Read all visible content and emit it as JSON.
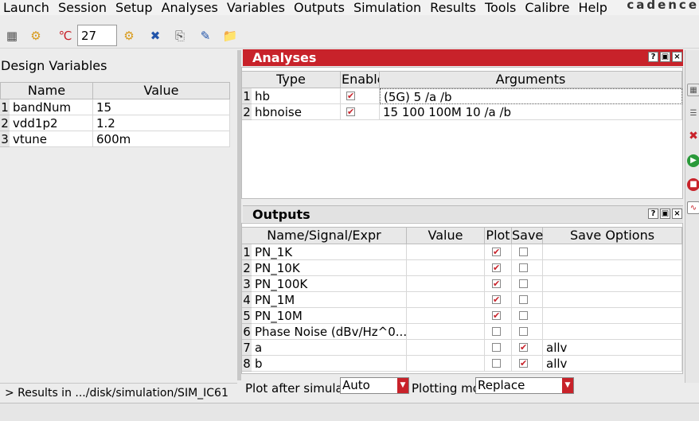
{
  "menu": {
    "items": [
      "Launch",
      "Session",
      "Setup",
      "Analyses",
      "Variables",
      "Outputs",
      "Simulation",
      "Results",
      "Tools",
      "Calibre",
      "Help"
    ],
    "brand": "cadence"
  },
  "toolbar": {
    "temperature": "27"
  },
  "design_variables": {
    "title": "Design Variables",
    "headers": [
      "Name",
      "Value"
    ],
    "rows": [
      {
        "num": "1",
        "name": "bandNum",
        "value": "15"
      },
      {
        "num": "2",
        "name": "vdd1p2",
        "value": "1.2"
      },
      {
        "num": "3",
        "name": "vtune",
        "value": "600m"
      }
    ]
  },
  "analyses": {
    "title": "Analyses",
    "headers": [
      "Type",
      "Enable",
      "Arguments"
    ],
    "rows": [
      {
        "num": "1",
        "type": "hb",
        "enabled": true,
        "args": "(5G) 5 /a /b"
      },
      {
        "num": "2",
        "type": "hbnoise",
        "enabled": true,
        "args": "15 100 100M 10 /a /b"
      }
    ]
  },
  "outputs": {
    "title": "Outputs",
    "headers": [
      "Name/Signal/Expr",
      "Value",
      "Plot",
      "Save",
      "Save Options"
    ],
    "rows": [
      {
        "num": "1",
        "name": "PN_1K",
        "value": "",
        "plot": true,
        "save": false,
        "opt": ""
      },
      {
        "num": "2",
        "name": "PN_10K",
        "value": "",
        "plot": true,
        "save": false,
        "opt": ""
      },
      {
        "num": "3",
        "name": "PN_100K",
        "value": "",
        "plot": true,
        "save": false,
        "opt": ""
      },
      {
        "num": "4",
        "name": "PN_1M",
        "value": "",
        "plot": true,
        "save": false,
        "opt": ""
      },
      {
        "num": "5",
        "name": "PN_10M",
        "value": "",
        "plot": true,
        "save": false,
        "opt": ""
      },
      {
        "num": "6",
        "name": "Phase Noise (dBv/Hz^0...",
        "value": "",
        "plot": false,
        "save": false,
        "opt": ""
      },
      {
        "num": "7",
        "name": "a",
        "value": "",
        "plot": false,
        "save": true,
        "opt": "allv"
      },
      {
        "num": "8",
        "name": "b",
        "value": "",
        "plot": false,
        "save": true,
        "opt": "allv"
      }
    ]
  },
  "plotting": {
    "plot_after_label": "Plot after simula",
    "plot_after_value": "Auto",
    "plotting_mode_label": "Plotting mo",
    "plotting_mode_value": "Replace"
  },
  "status": {
    "text": "> Results in .../disk/simulation/SIM_IC61"
  },
  "colors": {
    "accent": "#c8222a"
  }
}
